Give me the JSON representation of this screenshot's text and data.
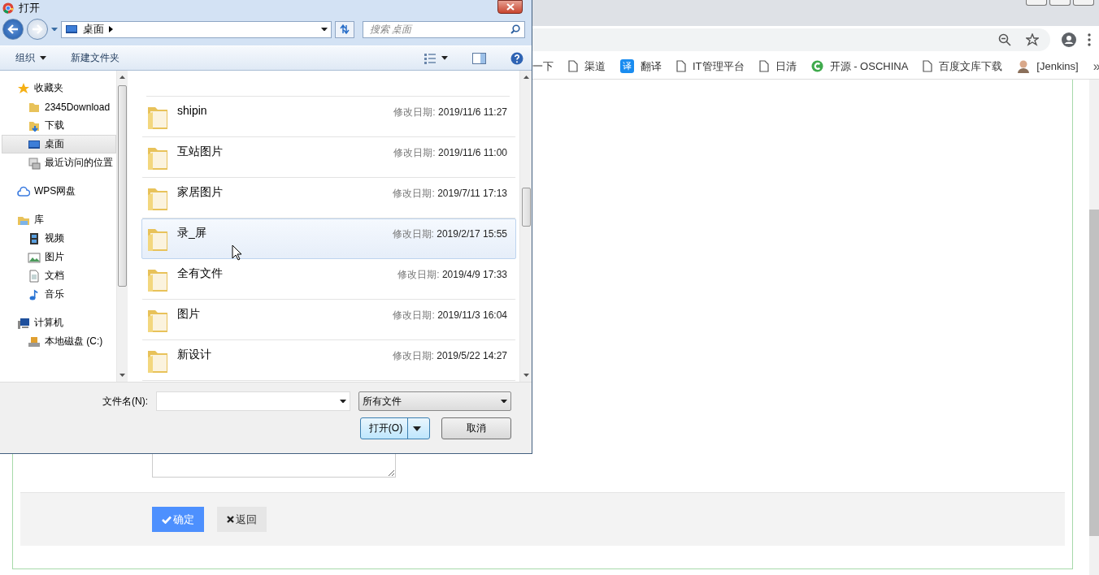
{
  "browser": {
    "bookmarks": [
      {
        "label": "一下",
        "kind": "none"
      },
      {
        "label": "渠道",
        "kind": "page"
      },
      {
        "label": "翻译",
        "kind": "translate",
        "badge": "译"
      },
      {
        "label": "IT管理平台",
        "kind": "page"
      },
      {
        "label": "日清",
        "kind": "page"
      },
      {
        "label": "开源 - OSCHINA",
        "kind": "oschina"
      },
      {
        "label": "百度文库下载",
        "kind": "page"
      },
      {
        "label": "[Jenkins]",
        "kind": "avatar"
      }
    ],
    "more": "»"
  },
  "page": {
    "buttons": [
      {
        "label": "确定",
        "kind": "primary"
      },
      {
        "label": "返回",
        "kind": "secondary"
      }
    ]
  },
  "dialog": {
    "title": "打开",
    "address": "桌面",
    "search": {
      "placeholder": "搜索 桌面"
    },
    "toolbar": {
      "organize": "组织",
      "new_folder": "新建文件夹"
    },
    "nav": [
      {
        "label": "收藏夹",
        "kind": "star",
        "children": [
          {
            "label": "2345Download",
            "kind": "folder",
            "selected": false
          },
          {
            "label": "下载",
            "kind": "download",
            "selected": false
          },
          {
            "label": "桌面",
            "kind": "desktop",
            "selected": true
          },
          {
            "label": "最近访问的位置",
            "kind": "recent",
            "selected": false
          }
        ]
      },
      {
        "label": "WPS网盘",
        "kind": "cloud"
      },
      {
        "label": "库",
        "kind": "library",
        "children": [
          {
            "label": "视频",
            "kind": "video",
            "selected": false
          },
          {
            "label": "图片",
            "kind": "image",
            "selected": false
          },
          {
            "label": "文档",
            "kind": "document",
            "selected": false
          },
          {
            "label": "音乐",
            "kind": "music",
            "selected": false
          }
        ]
      },
      {
        "label": "计算机",
        "kind": "computer",
        "children": [
          {
            "label": "本地磁盘 (C:)",
            "kind": "drive",
            "selected": false
          }
        ]
      }
    ],
    "files": [
      {
        "name": "shipin",
        "date_label": "修改日期:",
        "date": "2019/11/6 11:27",
        "selected": false
      },
      {
        "name": "互站图片",
        "date_label": "修改日期:",
        "date": "2019/11/6 11:00",
        "selected": false
      },
      {
        "name": "家居图片",
        "date_label": "修改日期:",
        "date": "2019/7/11 17:13",
        "selected": false
      },
      {
        "name": "录_屏",
        "date_label": "修改日期:",
        "date": "2019/2/17 15:55",
        "selected": true
      },
      {
        "name": "全有文件",
        "date_label": "修改日期:",
        "date": "2019/4/9 17:33",
        "selected": false
      },
      {
        "name": "图片",
        "date_label": "修改日期:",
        "date": "2019/11/3 16:04",
        "selected": false
      },
      {
        "name": "新设计",
        "date_label": "修改日期:",
        "date": "2019/5/22 14:27",
        "selected": false
      }
    ],
    "filename_label": "文件名(N):",
    "filetype": "所有文件",
    "buttons": [
      {
        "label": "打开(O)",
        "kind": "split"
      },
      {
        "label": "取消",
        "kind": "plain"
      }
    ]
  }
}
